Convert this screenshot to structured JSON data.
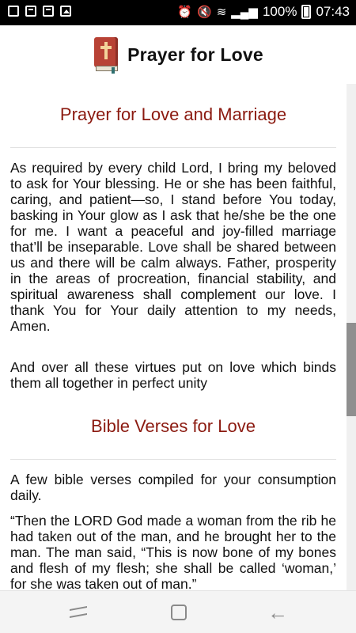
{
  "status_bar": {
    "battery": "100%",
    "time": "07:43",
    "icons": [
      "notification-icon",
      "app-icon",
      "document-icon",
      "image-icon",
      "alarm-icon",
      "mute-icon",
      "wifi-icon",
      "signal-icon",
      "battery-icon"
    ]
  },
  "header": {
    "title": "Prayer for Love",
    "icon": "bible-book-icon"
  },
  "sections": [
    {
      "title": "Prayer for Love and Marriage",
      "paragraphs": [
        "As required by every child Lord, I bring my beloved to ask for Your blessing. He or she has been faithful, caring, and patient—so, I stand before You today, basking in Your glow as I ask that he/she be the one for me. I want a peaceful and joy-filled marriage that’ll be inseparable. Love shall be shared between us and there will be calm always. Father, prosperity in the areas of procreation, financial stability, and spiritual awareness shall complement our love. I thank You for Your daily attention to my needs, Amen.",
        "And over all these virtues put on love which binds them all together in perfect unity"
      ]
    },
    {
      "title": "Bible Verses for Love",
      "paragraphs": [
        "A few bible verses compiled for your consumption daily.",
        "“Then the LORD God made a woman from the rib he had taken out of the man, and he brought her to the man. The man said, “This is now bone of my bones and flesh of my flesh; she shall be called ‘woman,’ for she was taken out of man.”"
      ]
    }
  ],
  "colors": {
    "section_title": "#8b1a10",
    "status_bar_bg": "#000000",
    "nav_bar_bg": "#f4f4f4",
    "scroll_thumb": "#8f8f8f"
  },
  "nav_bar": {
    "icons": [
      "recent-apps-icon",
      "home-icon",
      "back-icon"
    ]
  }
}
